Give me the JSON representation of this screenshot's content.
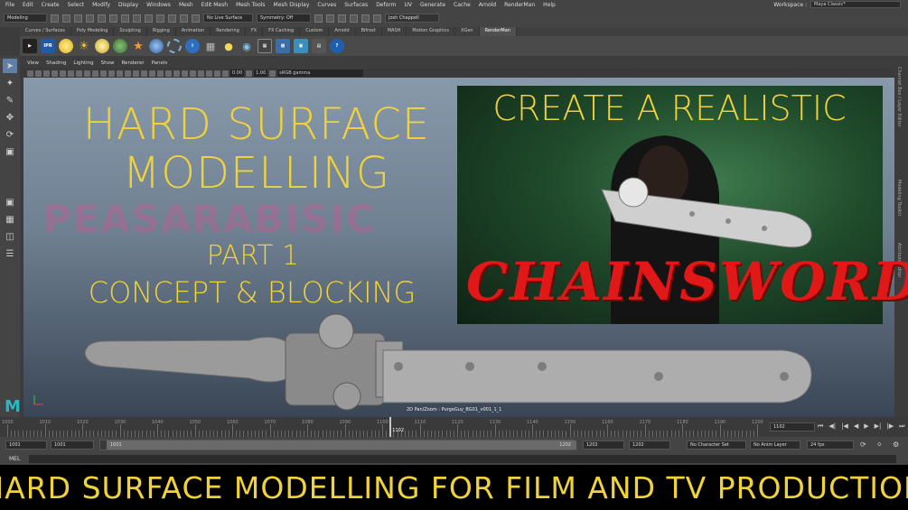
{
  "menubar": {
    "items": [
      "File",
      "Edit",
      "Create",
      "Select",
      "Modify",
      "Display",
      "Windows",
      "Mesh",
      "Edit Mesh",
      "Mesh Tools",
      "Mesh Display",
      "Curves",
      "Surfaces",
      "Deform",
      "UV",
      "Generate",
      "Cache",
      "Arnold",
      "RenderMan",
      "Help"
    ],
    "workspace_label": "Workspace :",
    "workspace_value": "Maya Classic*"
  },
  "statusline": {
    "menuset": "Modeling",
    "live_surface": "No Live Surface",
    "symmetry": "Symmetry: Off",
    "user": "Josh Chappell"
  },
  "shelf": {
    "tabs": [
      "Curves / Surfaces",
      "Poly Modeling",
      "Sculpting",
      "Rigging",
      "Animation",
      "Rendering",
      "FX",
      "FX Caching",
      "Custom",
      "Arnold",
      "Bifrost",
      "MASH",
      "Motion Graphics",
      "XGen",
      "RenderMan"
    ],
    "active_tab": "RenderMan",
    "ipr_label": "IPR"
  },
  "panel": {
    "menus": [
      "View",
      "Shading",
      "Lighting",
      "Show",
      "Renderer",
      "Panels"
    ],
    "exposure": "0.00",
    "gamma": "1.00",
    "colorspace": "sRGB gamma"
  },
  "right_panel": {
    "labels": [
      "Channel Box / Layer Editor",
      "Modeling Toolkit",
      "Attribute Editor"
    ]
  },
  "thumbnail": {
    "title_line1": "HARD SURFACE",
    "title_line2": "MODELLING",
    "ghost_text": "PEASARABISIC",
    "part": "PART 1",
    "subtitle": "CONCEPT & BLOCKING",
    "photo_title": "CREATE A REALISTIC",
    "photo_word": "CHAINSWORD",
    "banner": "HARD SURFACE MODELLING FOR FILM AND TV PRODUCTION"
  },
  "viewport": {
    "hud": "2D Pan/Zoom : PurgeGuy_BG01_v001_1_1",
    "logo": "M"
  },
  "timeline": {
    "ticks": [
      "1000",
      "1010",
      "1020",
      "1030",
      "1040",
      "1050",
      "1060",
      "1070",
      "1080",
      "1090",
      "1100",
      "1110",
      "1120",
      "1130",
      "1140",
      "1150",
      "1160",
      "1170",
      "1180",
      "1190",
      "1200"
    ],
    "marker": "1102",
    "current_frame": "1102"
  },
  "range": {
    "start": "1001",
    "start_inner": "1001",
    "handle_start": "1001",
    "handle_end": "1202",
    "end_inner": "1202",
    "end": "1202",
    "character_set": "No Character Set",
    "anim_layer": "No Anim Layer",
    "fps": "24 fps"
  },
  "mel": {
    "label": "MEL"
  }
}
